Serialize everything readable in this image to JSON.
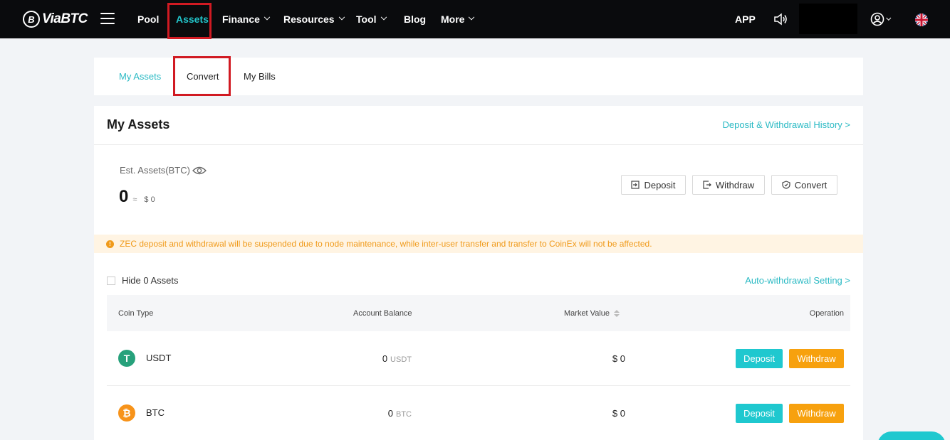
{
  "brand": {
    "logo_mark": "B",
    "logo_text": "ViaBTC"
  },
  "nav": {
    "items": [
      {
        "label": "Pool",
        "dropdown": false
      },
      {
        "label": "Assets",
        "dropdown": false,
        "active": true
      },
      {
        "label": "Finance",
        "dropdown": true
      },
      {
        "label": "Resources",
        "dropdown": true
      },
      {
        "label": "Tool",
        "dropdown": true
      },
      {
        "label": "Blog",
        "dropdown": false
      },
      {
        "label": "More",
        "dropdown": true
      }
    ],
    "app_label": "APP",
    "icons": [
      "menu-icon",
      "speaker-icon",
      "user-icon",
      "uk-flag-icon"
    ]
  },
  "tabs": [
    {
      "label": "My Assets",
      "active": true
    },
    {
      "label": "Convert",
      "active": false
    },
    {
      "label": "My Bills",
      "active": false
    }
  ],
  "assets": {
    "title": "My Assets",
    "history_link": "Deposit & Withdrawal History >",
    "est_label": "Est. Assets(BTC)",
    "est_value": "0",
    "approx_symbol": "≈",
    "usd_value": "$ 0",
    "actions": {
      "deposit": "Deposit",
      "withdraw": "Withdraw",
      "convert": "Convert"
    }
  },
  "notice": {
    "text": "ZEC deposit and withdrawal will be suspended due to node maintenance, while inter-user transfer and transfer to CoinEx will not be affected."
  },
  "filter": {
    "hide_zero_label": "Hide 0 Assets",
    "hide_zero_checked": false,
    "auto_withdrawal_link": "Auto-withdrawal Setting >"
  },
  "table": {
    "headers": {
      "coin_type": "Coin Type",
      "balance": "Account Balance",
      "market_value": "Market Value",
      "operation": "Operation"
    },
    "rows": [
      {
        "coin": "USDT",
        "icon": "tether-icon",
        "icon_glyph": "T",
        "icon_color": "#26a17b",
        "balance": "0",
        "unit": "USDT",
        "market_value": "$ 0",
        "deposit": "Deposit",
        "withdraw": "Withdraw"
      },
      {
        "coin": "BTC",
        "icon": "bitcoin-icon",
        "icon_glyph": "₿",
        "icon_color": "#f7931a",
        "balance": "0",
        "unit": "BTC",
        "market_value": "$ 0",
        "deposit": "Deposit",
        "withdraw": "Withdraw"
      }
    ]
  },
  "colors": {
    "accent": "#22c3c8",
    "deposit_button": "#1fc8cf",
    "withdraw_button": "#f7a10e",
    "notice_text": "#f09a1a",
    "highlight_box": "#d11a22"
  }
}
